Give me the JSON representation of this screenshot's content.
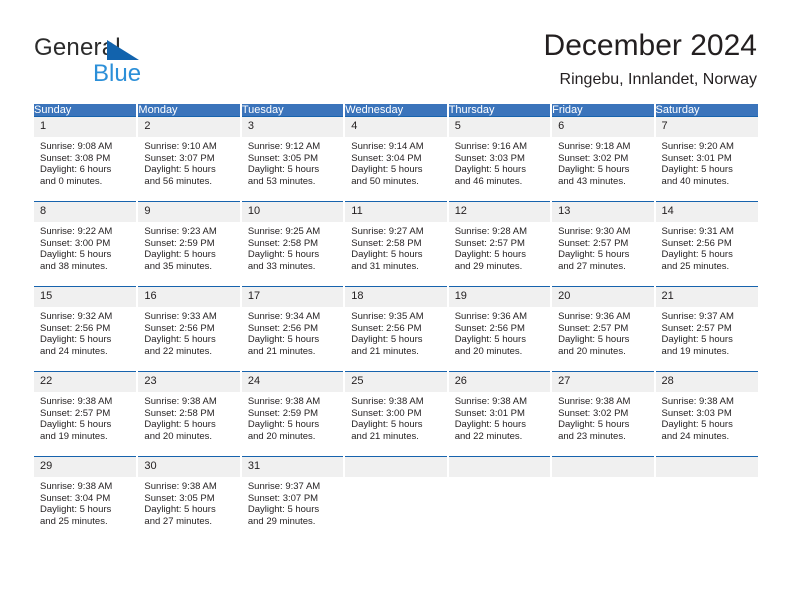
{
  "brand": {
    "name_primary": "General",
    "name_secondary": "Blue",
    "triangle_icon": "blue-triangle-icon"
  },
  "header": {
    "title": "December 2024",
    "subtitle": "Ringebu, Innlandet, Norway"
  },
  "colors": {
    "header_blue": "#3b74bb",
    "row_border_blue": "#1763ad",
    "daynum_band": "#f0f0f0",
    "logo_blue": "#1263ad",
    "logo_text_blue": "#2b8fd8",
    "text": "#231f20"
  },
  "weekdays": [
    "Sunday",
    "Monday",
    "Tuesday",
    "Wednesday",
    "Thursday",
    "Friday",
    "Saturday"
  ],
  "labels": {
    "sunrise_prefix": "Sunrise:",
    "sunset_prefix": "Sunset:",
    "daylight_prefix": "Daylight:"
  },
  "weeks": [
    [
      {
        "day": "1",
        "line1": "Sunrise: 9:08 AM",
        "line2": "Sunset: 3:08 PM",
        "line3": "Daylight: 6 hours",
        "line4": "and 0 minutes."
      },
      {
        "day": "2",
        "line1": "Sunrise: 9:10 AM",
        "line2": "Sunset: 3:07 PM",
        "line3": "Daylight: 5 hours",
        "line4": "and 56 minutes."
      },
      {
        "day": "3",
        "line1": "Sunrise: 9:12 AM",
        "line2": "Sunset: 3:05 PM",
        "line3": "Daylight: 5 hours",
        "line4": "and 53 minutes."
      },
      {
        "day": "4",
        "line1": "Sunrise: 9:14 AM",
        "line2": "Sunset: 3:04 PM",
        "line3": "Daylight: 5 hours",
        "line4": "and 50 minutes."
      },
      {
        "day": "5",
        "line1": "Sunrise: 9:16 AM",
        "line2": "Sunset: 3:03 PM",
        "line3": "Daylight: 5 hours",
        "line4": "and 46 minutes."
      },
      {
        "day": "6",
        "line1": "Sunrise: 9:18 AM",
        "line2": "Sunset: 3:02 PM",
        "line3": "Daylight: 5 hours",
        "line4": "and 43 minutes."
      },
      {
        "day": "7",
        "line1": "Sunrise: 9:20 AM",
        "line2": "Sunset: 3:01 PM",
        "line3": "Daylight: 5 hours",
        "line4": "and 40 minutes."
      }
    ],
    [
      {
        "day": "8",
        "line1": "Sunrise: 9:22 AM",
        "line2": "Sunset: 3:00 PM",
        "line3": "Daylight: 5 hours",
        "line4": "and 38 minutes."
      },
      {
        "day": "9",
        "line1": "Sunrise: 9:23 AM",
        "line2": "Sunset: 2:59 PM",
        "line3": "Daylight: 5 hours",
        "line4": "and 35 minutes."
      },
      {
        "day": "10",
        "line1": "Sunrise: 9:25 AM",
        "line2": "Sunset: 2:58 PM",
        "line3": "Daylight: 5 hours",
        "line4": "and 33 minutes."
      },
      {
        "day": "11",
        "line1": "Sunrise: 9:27 AM",
        "line2": "Sunset: 2:58 PM",
        "line3": "Daylight: 5 hours",
        "line4": "and 31 minutes."
      },
      {
        "day": "12",
        "line1": "Sunrise: 9:28 AM",
        "line2": "Sunset: 2:57 PM",
        "line3": "Daylight: 5 hours",
        "line4": "and 29 minutes."
      },
      {
        "day": "13",
        "line1": "Sunrise: 9:30 AM",
        "line2": "Sunset: 2:57 PM",
        "line3": "Daylight: 5 hours",
        "line4": "and 27 minutes."
      },
      {
        "day": "14",
        "line1": "Sunrise: 9:31 AM",
        "line2": "Sunset: 2:56 PM",
        "line3": "Daylight: 5 hours",
        "line4": "and 25 minutes."
      }
    ],
    [
      {
        "day": "15",
        "line1": "Sunrise: 9:32 AM",
        "line2": "Sunset: 2:56 PM",
        "line3": "Daylight: 5 hours",
        "line4": "and 24 minutes."
      },
      {
        "day": "16",
        "line1": "Sunrise: 9:33 AM",
        "line2": "Sunset: 2:56 PM",
        "line3": "Daylight: 5 hours",
        "line4": "and 22 minutes."
      },
      {
        "day": "17",
        "line1": "Sunrise: 9:34 AM",
        "line2": "Sunset: 2:56 PM",
        "line3": "Daylight: 5 hours",
        "line4": "and 21 minutes."
      },
      {
        "day": "18",
        "line1": "Sunrise: 9:35 AM",
        "line2": "Sunset: 2:56 PM",
        "line3": "Daylight: 5 hours",
        "line4": "and 21 minutes."
      },
      {
        "day": "19",
        "line1": "Sunrise: 9:36 AM",
        "line2": "Sunset: 2:56 PM",
        "line3": "Daylight: 5 hours",
        "line4": "and 20 minutes."
      },
      {
        "day": "20",
        "line1": "Sunrise: 9:36 AM",
        "line2": "Sunset: 2:57 PM",
        "line3": "Daylight: 5 hours",
        "line4": "and 20 minutes."
      },
      {
        "day": "21",
        "line1": "Sunrise: 9:37 AM",
        "line2": "Sunset: 2:57 PM",
        "line3": "Daylight: 5 hours",
        "line4": "and 19 minutes."
      }
    ],
    [
      {
        "day": "22",
        "line1": "Sunrise: 9:38 AM",
        "line2": "Sunset: 2:57 PM",
        "line3": "Daylight: 5 hours",
        "line4": "and 19 minutes."
      },
      {
        "day": "23",
        "line1": "Sunrise: 9:38 AM",
        "line2": "Sunset: 2:58 PM",
        "line3": "Daylight: 5 hours",
        "line4": "and 20 minutes."
      },
      {
        "day": "24",
        "line1": "Sunrise: 9:38 AM",
        "line2": "Sunset: 2:59 PM",
        "line3": "Daylight: 5 hours",
        "line4": "and 20 minutes."
      },
      {
        "day": "25",
        "line1": "Sunrise: 9:38 AM",
        "line2": "Sunset: 3:00 PM",
        "line3": "Daylight: 5 hours",
        "line4": "and 21 minutes."
      },
      {
        "day": "26",
        "line1": "Sunrise: 9:38 AM",
        "line2": "Sunset: 3:01 PM",
        "line3": "Daylight: 5 hours",
        "line4": "and 22 minutes."
      },
      {
        "day": "27",
        "line1": "Sunrise: 9:38 AM",
        "line2": "Sunset: 3:02 PM",
        "line3": "Daylight: 5 hours",
        "line4": "and 23 minutes."
      },
      {
        "day": "28",
        "line1": "Sunrise: 9:38 AM",
        "line2": "Sunset: 3:03 PM",
        "line3": "Daylight: 5 hours",
        "line4": "and 24 minutes."
      }
    ],
    [
      {
        "day": "29",
        "line1": "Sunrise: 9:38 AM",
        "line2": "Sunset: 3:04 PM",
        "line3": "Daylight: 5 hours",
        "line4": "and 25 minutes."
      },
      {
        "day": "30",
        "line1": "Sunrise: 9:38 AM",
        "line2": "Sunset: 3:05 PM",
        "line3": "Daylight: 5 hours",
        "line4": "and 27 minutes."
      },
      {
        "day": "31",
        "line1": "Sunrise: 9:37 AM",
        "line2": "Sunset: 3:07 PM",
        "line3": "Daylight: 5 hours",
        "line4": "and 29 minutes."
      },
      {
        "day": "",
        "line1": "",
        "line2": "",
        "line3": "",
        "line4": ""
      },
      {
        "day": "",
        "line1": "",
        "line2": "",
        "line3": "",
        "line4": ""
      },
      {
        "day": "",
        "line1": "",
        "line2": "",
        "line3": "",
        "line4": ""
      },
      {
        "day": "",
        "line1": "",
        "line2": "",
        "line3": "",
        "line4": ""
      }
    ]
  ]
}
